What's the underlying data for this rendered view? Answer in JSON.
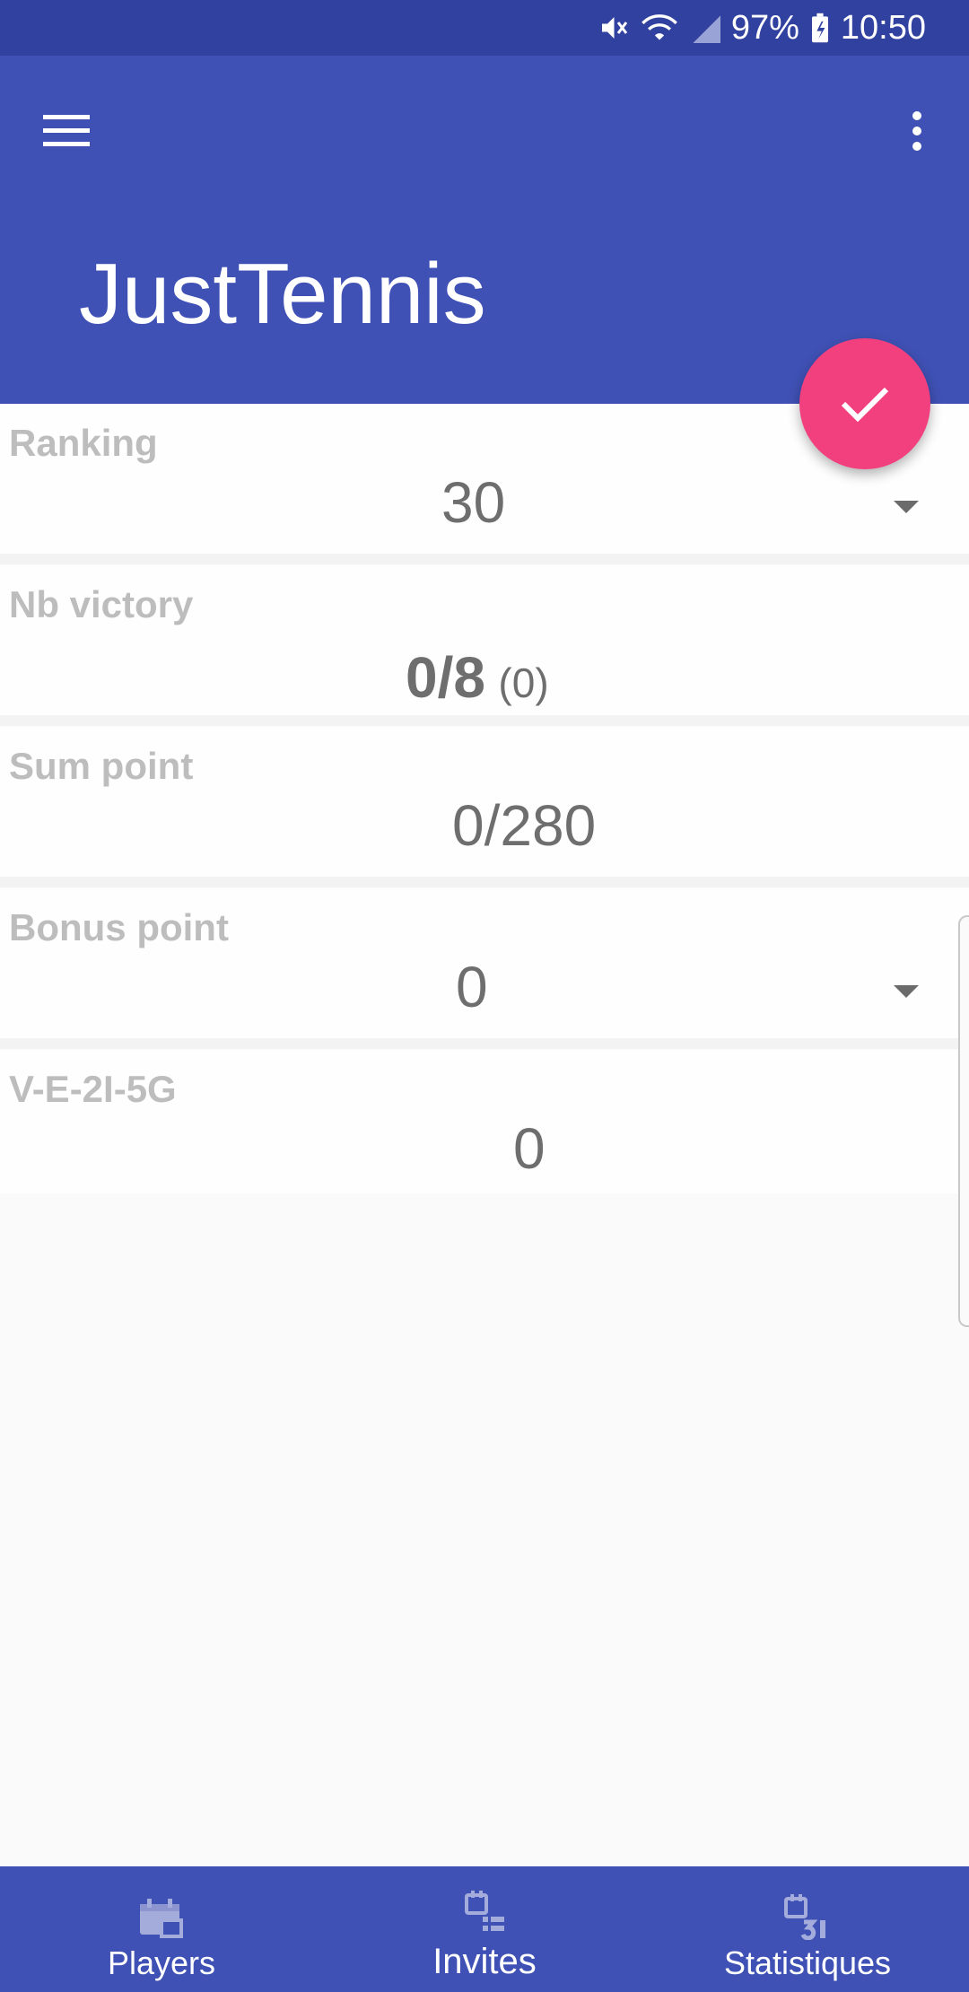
{
  "status_bar": {
    "battery": "97%",
    "time": "10:50"
  },
  "app_bar": {
    "title": "JustTennis"
  },
  "fields": {
    "ranking": {
      "label": "Ranking",
      "value": "30"
    },
    "nb_victory": {
      "label": "Nb victory",
      "value": "0/8",
      "extra": "(0)"
    },
    "sum_point": {
      "label": "Sum point",
      "value": "0/280"
    },
    "bonus_point": {
      "label": "Bonus point",
      "value": "0"
    },
    "vegs": {
      "label": "V-E-2I-5G",
      "value": "0"
    }
  },
  "bottom_nav": {
    "items": [
      {
        "label": "Players",
        "icon": "players-calendar-icon"
      },
      {
        "label": "Invites",
        "icon": "invites-list-icon"
      },
      {
        "label": "Statistiques",
        "icon": "statistics-calendar-icon"
      }
    ]
  },
  "colors": {
    "primary": "#3f51b5",
    "primary_dark": "#3141a0",
    "accent": "#f2407f"
  }
}
